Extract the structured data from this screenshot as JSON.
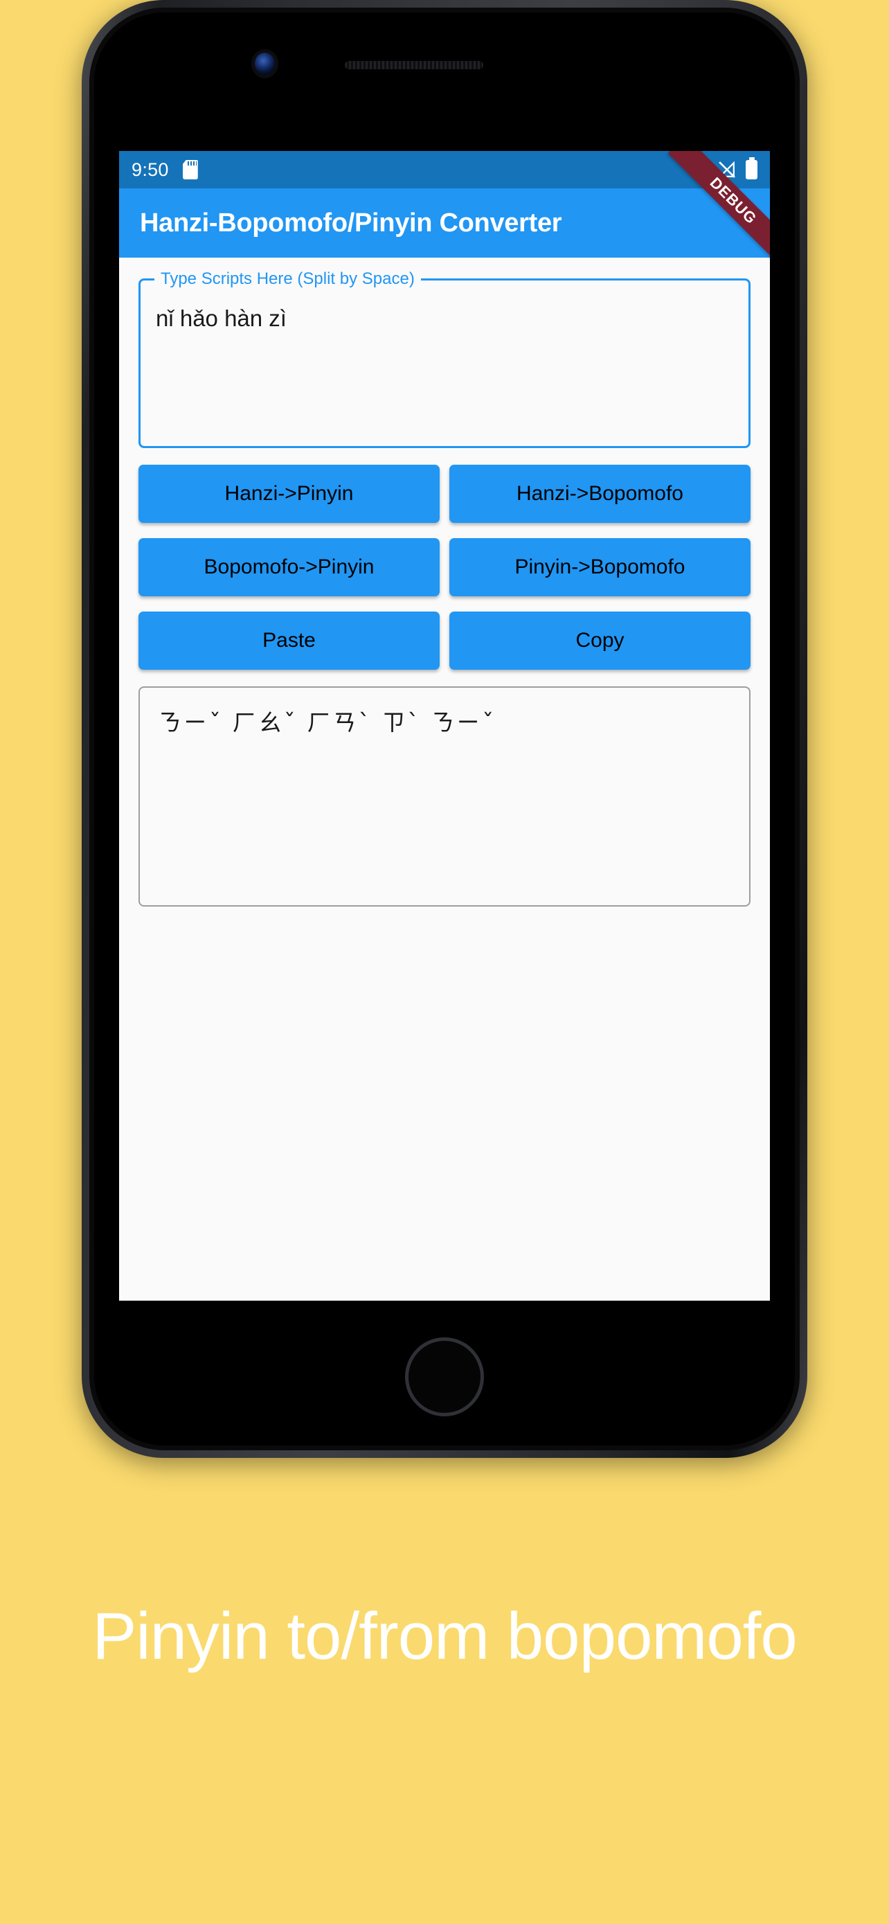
{
  "device": {
    "camera_icon": "front-camera-icon",
    "speaker_icon": "earpiece-speaker-icon",
    "home_button_label": "",
    "buttons": [
      "silent-switch",
      "volume-up",
      "volume-down",
      "power"
    ]
  },
  "status_bar": {
    "time": "9:50",
    "icons": [
      "sd-card-icon",
      "wifi-icon",
      "signal-off-icon",
      "battery-icon"
    ],
    "background": "#1573b9"
  },
  "app_bar": {
    "title": "Hanzi-Bopomofo/Pinyin Converter",
    "background": "#2196f3",
    "ribbon_label": "DEBUG",
    "ribbon_color": "#7b2030"
  },
  "input": {
    "legend": "Type Scripts Here (Split by Space)",
    "value": "nǐ hǎo hàn zì",
    "placeholder": "",
    "border_color": "#2196f3"
  },
  "buttons": {
    "rows": [
      [
        {
          "label": "Hanzi->Pinyin",
          "name": "hanzi-to-pinyin-button"
        },
        {
          "label": "Hanzi->Bopomofo",
          "name": "hanzi-to-bopomofo-button"
        }
      ],
      [
        {
          "label": "Bopomofo->Pinyin",
          "name": "bopomofo-to-pinyin-button"
        },
        {
          "label": "Pinyin->Bopomofo",
          "name": "pinyin-to-bopomofo-button"
        }
      ],
      [
        {
          "label": "Paste",
          "name": "paste-button"
        },
        {
          "label": "Copy",
          "name": "copy-button"
        }
      ]
    ],
    "color": "#2196f3"
  },
  "output": {
    "value": "ㄋㄧˇ ㄏㄠˇ ㄏㄢˋ ㄗˋ ㄋㄧˇ",
    "border_color": "#9e9e9e"
  },
  "caption": {
    "text": "Pinyin to/from bopomofo",
    "color": "#ffffff"
  },
  "page": {
    "background": "#fada6e"
  }
}
